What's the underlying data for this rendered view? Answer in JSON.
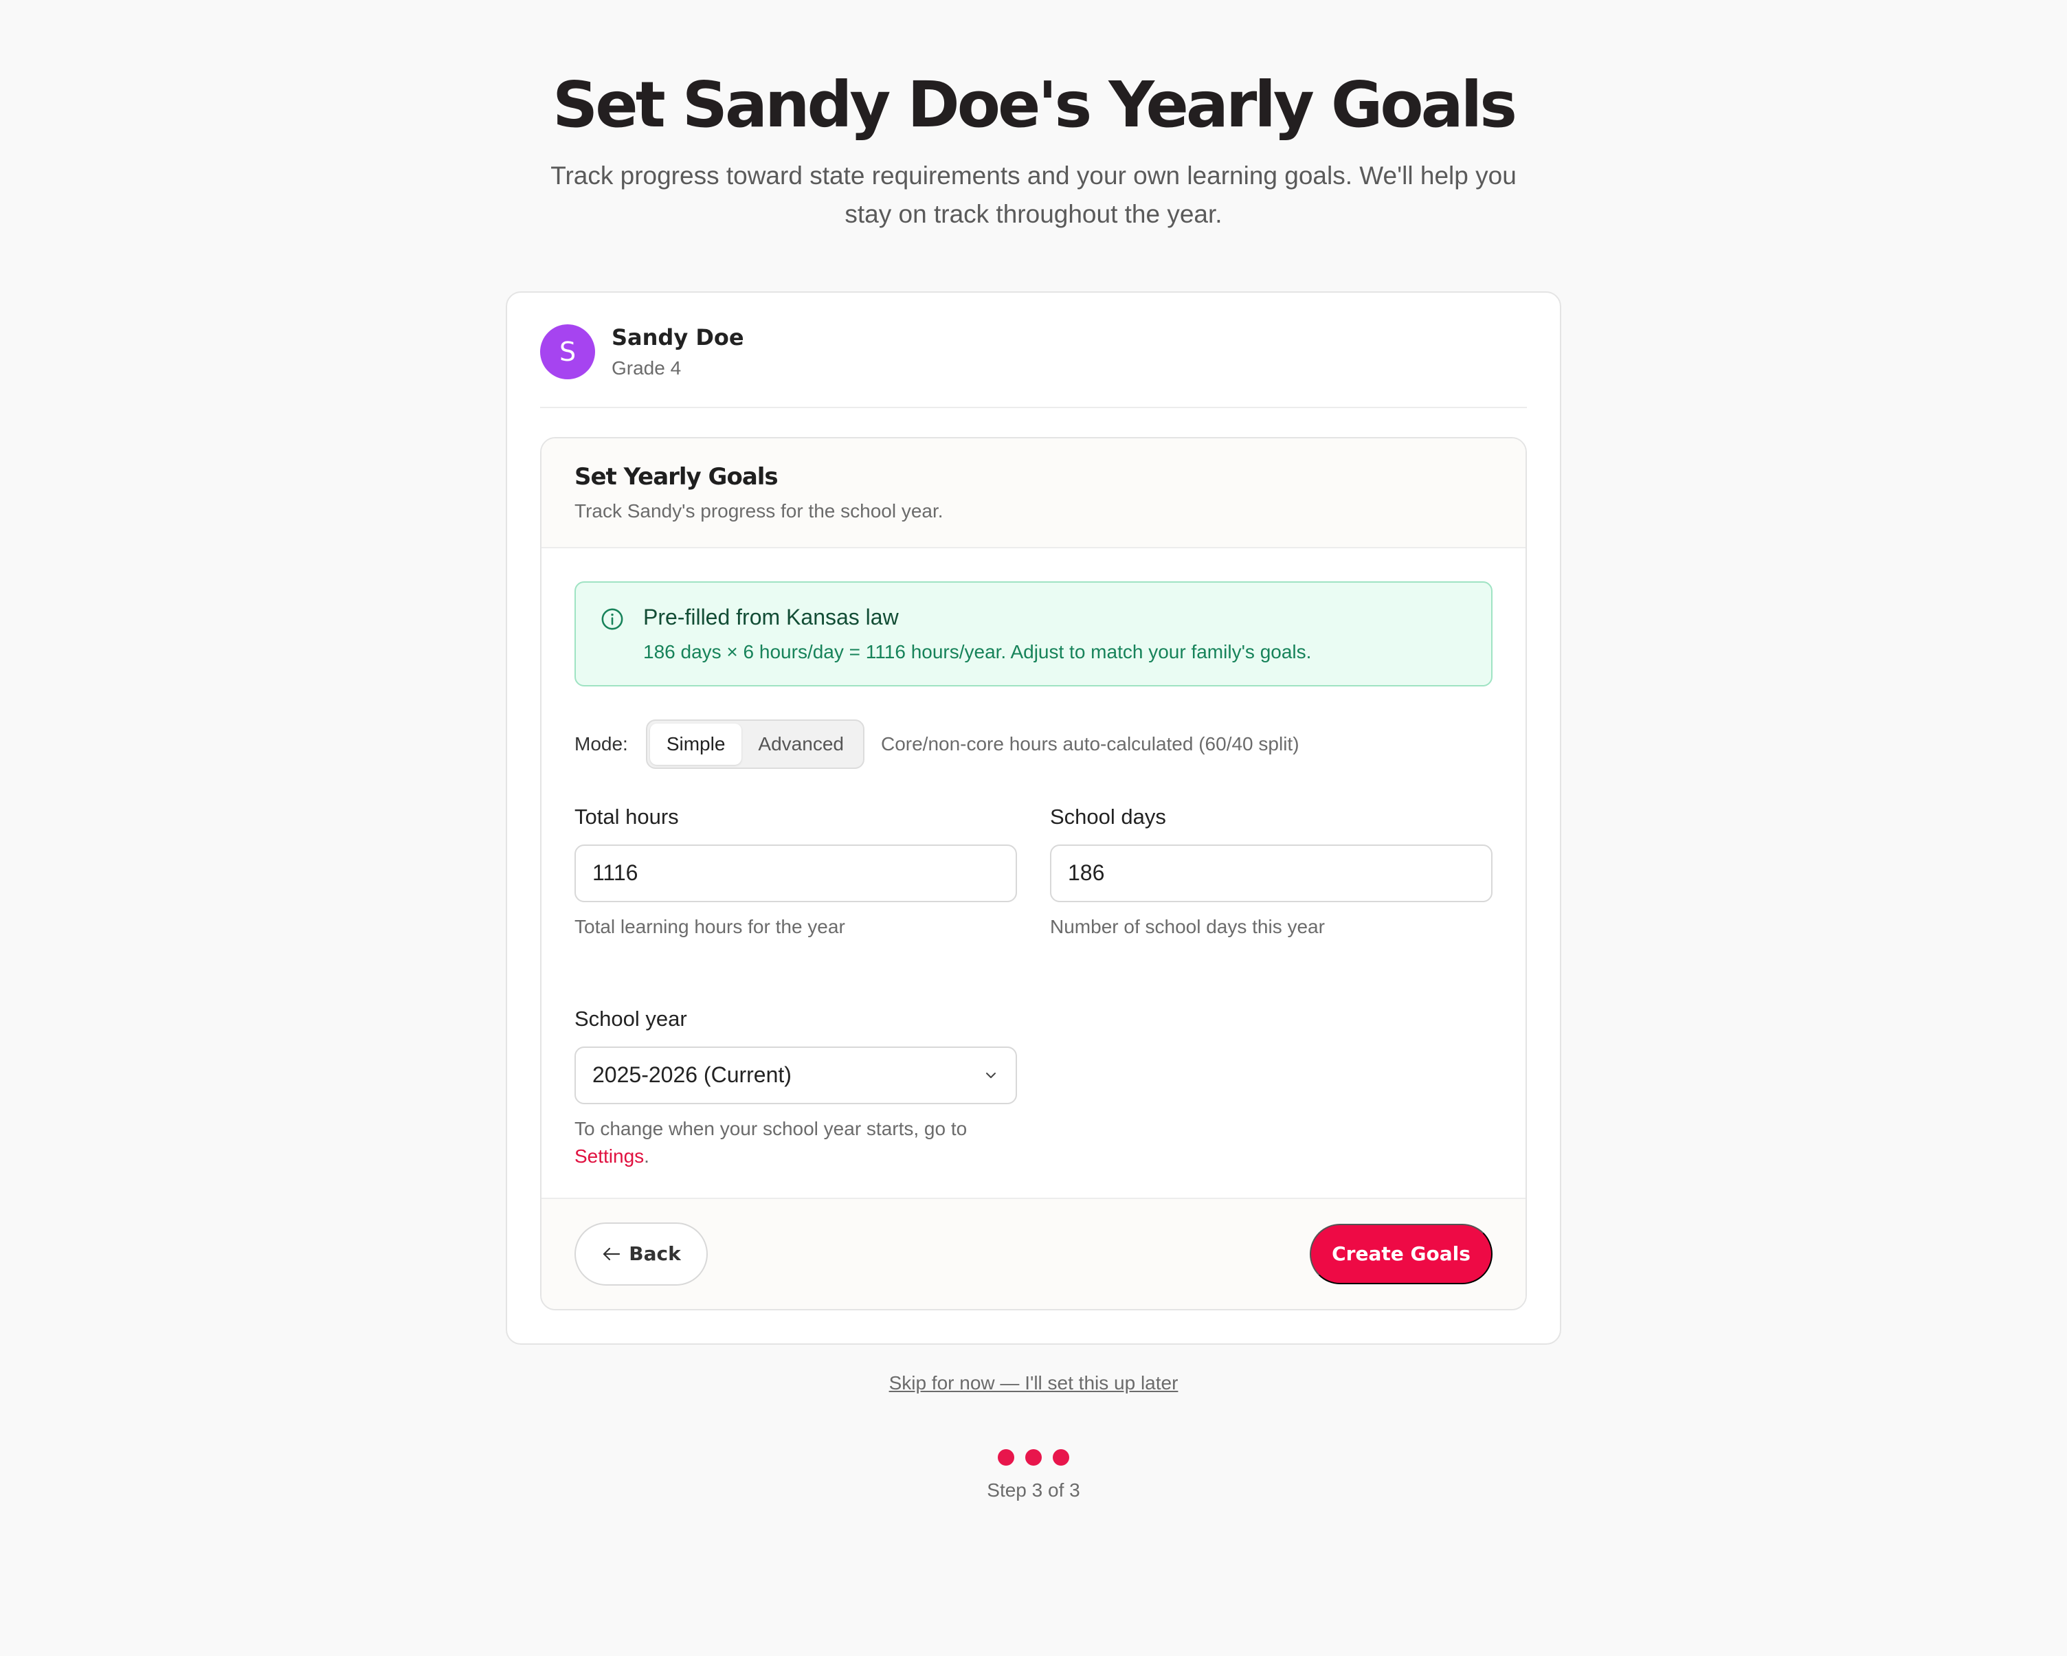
{
  "header": {
    "title": "Set Sandy Doe's Yearly Goals",
    "subtitle": "Track progress toward state requirements and your own learning goals. We'll help you stay on track throughout the year."
  },
  "student": {
    "initial": "S",
    "name": "Sandy Doe",
    "grade": "Grade 4",
    "avatar_color": "#a644f0"
  },
  "goals": {
    "title": "Set Yearly Goals",
    "subtitle": "Track Sandy's progress for the school year.",
    "notice": {
      "icon": "info-icon",
      "title": "Pre-filled from Kansas law",
      "detail": "186 days × 6 hours/day = 1116 hours/year. Adjust to match your family's goals."
    },
    "mode": {
      "label": "Mode:",
      "options": [
        "Simple",
        "Advanced"
      ],
      "selected": "Simple",
      "hint": "Core/non-core hours auto-calculated (60/40 split)"
    },
    "total_hours": {
      "label": "Total hours",
      "value": "1116",
      "help": "Total learning hours for the year"
    },
    "school_days": {
      "label": "School days",
      "value": "186",
      "help": "Number of school days this year"
    },
    "school_year": {
      "label": "School year",
      "value": "2025-2026 (Current)",
      "help": "To change when your school year starts, go to",
      "link": "Settings",
      "help_end": "."
    }
  },
  "footer": {
    "back_label": "Back",
    "create_label": "Create Goals"
  },
  "skip_label": "Skip for now — I'll set this up later",
  "progress": {
    "current": 3,
    "total": 3,
    "label": "Step 3 of 3",
    "dot_color": "#e8164c"
  },
  "colors": {
    "accent": "#ee0a45",
    "notice_bg": "#eafcf3",
    "notice_border": "#9fe3c3"
  }
}
